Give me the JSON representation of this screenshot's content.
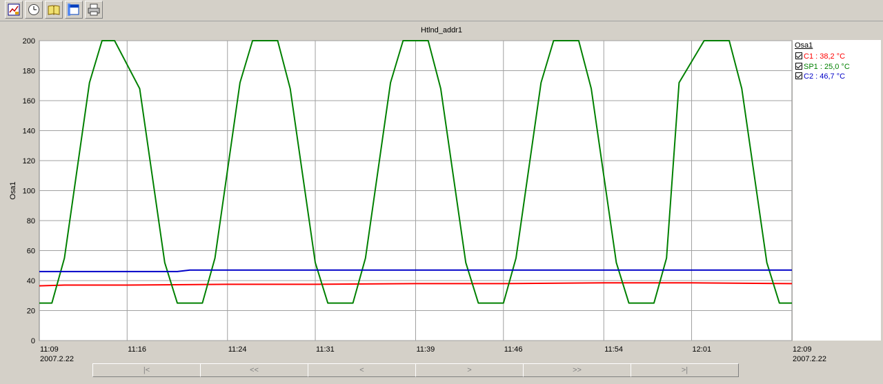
{
  "chart_data": {
    "type": "line",
    "title": "Htlnd_addr1",
    "ylabel": "Osa1",
    "xlabel": "",
    "ylim": [
      0,
      200
    ],
    "yticks": [
      0,
      20,
      40,
      60,
      80,
      100,
      120,
      140,
      160,
      180,
      200
    ],
    "xlim": [
      "11:09",
      "12:09"
    ],
    "xticks": [
      "11:09",
      "11:16",
      "11:24",
      "11:31",
      "11:39",
      "11:46",
      "11:54",
      "12:01",
      "12:09"
    ],
    "start_date": "2007.2.22",
    "end_date": "2007.2.22",
    "grid": true,
    "legend_title": "Osa1",
    "legend_position": "right",
    "series": [
      {
        "name": "C1 : 38,2 °C",
        "color": "#ff0000",
        "x": [
          "11:09",
          "11:11",
          "11:16",
          "11:24",
          "11:31",
          "11:39",
          "11:46",
          "11:54",
          "12:01",
          "12:09"
        ],
        "y": [
          36.5,
          37,
          37,
          37.5,
          37.5,
          38,
          38,
          38.5,
          38.5,
          38
        ]
      },
      {
        "name": "SP1 : 25,0 °C",
        "color": "#008000",
        "x": [
          "11:09",
          "11:10",
          "11:11",
          "11:13",
          "11:14",
          "11:15",
          "11:17",
          "11:19",
          "11:20",
          "11:22",
          "11:23",
          "11:25",
          "11:26",
          "11:28",
          "11:29",
          "11:31",
          "11:32",
          "11:34",
          "11:35",
          "11:37",
          "11:38",
          "11:40",
          "11:41",
          "11:43",
          "11:44",
          "11:46",
          "11:47",
          "11:49",
          "11:50",
          "11:52",
          "11:53",
          "11:55",
          "11:56",
          "11:58",
          "11:59",
          "12:00",
          "12:02",
          "12:04",
          "12:05",
          "12:07",
          "12:08",
          "12:09"
        ],
        "y": [
          25,
          25,
          55,
          172,
          200,
          200,
          168,
          52,
          25,
          25,
          55,
          172,
          200,
          200,
          168,
          52,
          25,
          25,
          55,
          172,
          200,
          200,
          168,
          52,
          25,
          25,
          55,
          172,
          200,
          200,
          168,
          52,
          25,
          25,
          55,
          172,
          200,
          200,
          168,
          52,
          25,
          25
        ]
      },
      {
        "name": "C2 : 46,7 °C",
        "color": "#0000c8",
        "x": [
          "11:09",
          "11:20",
          "11:21",
          "11:31",
          "11:32",
          "12:09"
        ],
        "y": [
          46,
          46,
          47,
          47,
          47,
          47
        ]
      }
    ]
  },
  "toolbar": {
    "icons": [
      "chart-settings-icon",
      "clock-icon",
      "book-icon",
      "window-icon",
      "printer-icon"
    ]
  },
  "nav": {
    "first": "|<",
    "fast_back": "<<",
    "back": "<",
    "forward": ">",
    "fast_forward": ">>",
    "last": ">|"
  }
}
